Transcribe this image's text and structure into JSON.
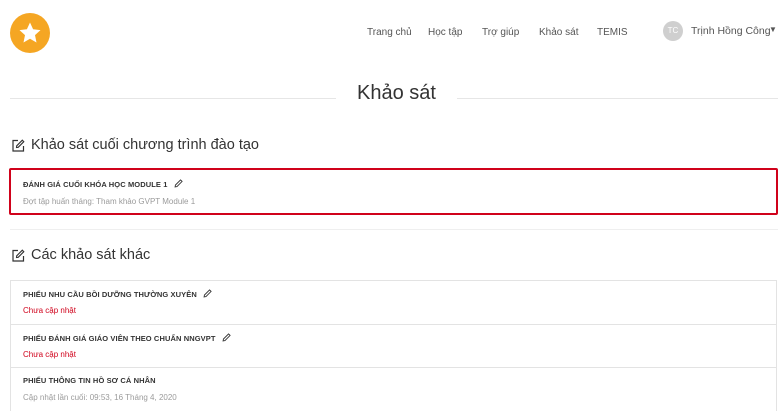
{
  "nav": {
    "items": [
      "Trang chủ",
      "Học tập",
      "Trợ giúp",
      "Khảo sát",
      "TEMIS"
    ]
  },
  "user": {
    "initials": "TC",
    "name": "Trịnh Hồng Công"
  },
  "page_title": "Khảo sát",
  "sections": {
    "final": {
      "heading": "Khảo sát cuối chương trình đào tạo",
      "card": {
        "title": "ĐÁNH GIÁ CUỐI KHÓA HỌC MODULE 1",
        "subtitle": "Đợt tập huấn tháng: Tham khảo GVPT Module 1"
      }
    },
    "other": {
      "heading": "Các khảo sát khác",
      "items": [
        {
          "title": "PHIẾU NHU CẦU BỒI DƯỠNG THƯỜNG XUYÊN",
          "status": "Chưa cập nhật"
        },
        {
          "title": "PHIẾU ĐÁNH GIÁ GIÁO VIÊN THEO CHUẨN NNGVPT",
          "status": "Chưa cập nhật"
        },
        {
          "title": "PHIẾU THÔNG TIN HỒ SƠ CÁ NHÂN",
          "status": "Cập nhật lần cuối: 09:53, 16 Tháng 4, 2020"
        }
      ]
    }
  },
  "colors": {
    "brand": "#f5a623",
    "highlight": "#d0021b",
    "status_pending": "#d0021b",
    "status_updated": "#9b9b9b"
  },
  "icons": {
    "logo": "star-icon",
    "section": "edit-square-icon",
    "item": "pencil-icon",
    "user_menu": "caret-down-icon"
  }
}
